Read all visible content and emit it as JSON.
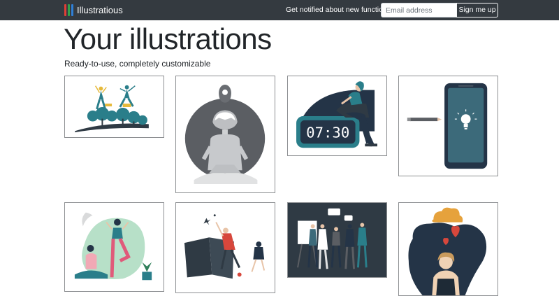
{
  "navbar": {
    "brand": "Illustratious",
    "logo_colors": [
      "#e03e36",
      "#2fa34a",
      "#2f7fd6"
    ],
    "notify_text": "Get notified about new functions",
    "email_placeholder": "Email address",
    "signup_label": "Sign me up"
  },
  "hero": {
    "title": "Your illustrations",
    "subtitle": "Ready-to-use, completely customizable"
  },
  "illustrations": [
    {
      "icon": "dancing-women-trees-illustration"
    },
    {
      "icon": "person-map-pin-circle-illustration"
    },
    {
      "icon": "woman-on-alarm-clock-illustration",
      "clock_text": "07:30"
    },
    {
      "icon": "smartphone-lightbulb-pencil-illustration"
    },
    {
      "icon": "yoga-women-illustration"
    },
    {
      "icon": "book-running-people-illustration"
    },
    {
      "icon": "team-presentation-illustration"
    },
    {
      "icon": "woman-hearts-cloud-illustration"
    }
  ],
  "colors": {
    "navbar_bg": "#343a40",
    "teal": "#2a7e8a",
    "navy": "#243447",
    "accent_red": "#d7473c"
  }
}
